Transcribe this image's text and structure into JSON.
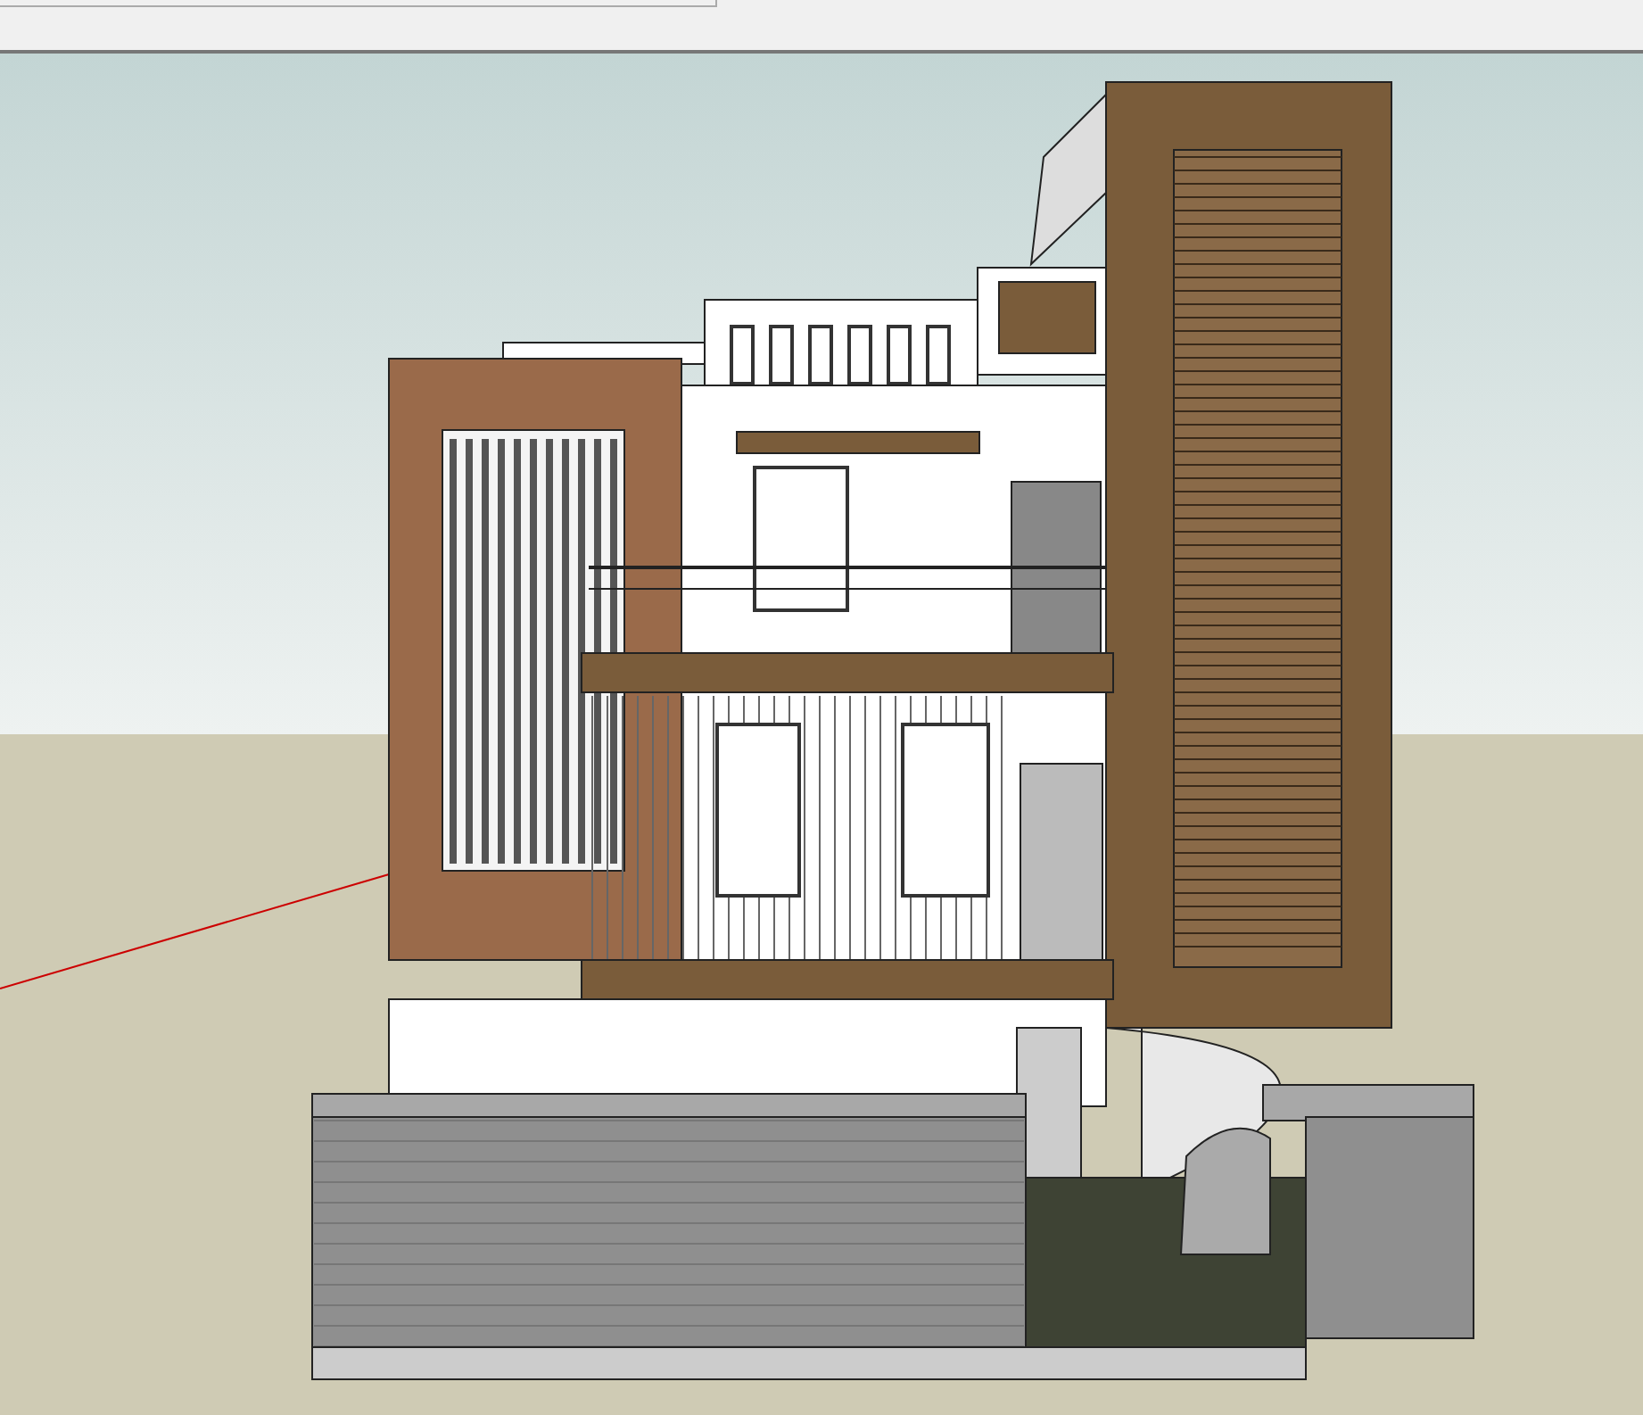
{
  "viewport": {
    "axis_visible": true
  }
}
